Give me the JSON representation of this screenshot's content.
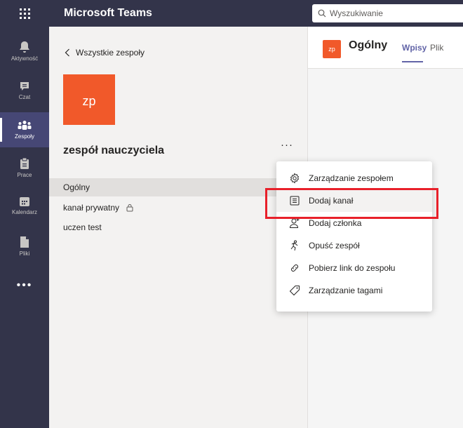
{
  "topbar": {
    "app_title": "Microsoft Teams",
    "search_placeholder": "Wyszukiwanie"
  },
  "rail": {
    "items": [
      {
        "label": "Aktywność",
        "icon": "bell-icon"
      },
      {
        "label": "Czat",
        "icon": "chat-icon"
      },
      {
        "label": "Zespoły",
        "icon": "teams-icon"
      },
      {
        "label": "Prace",
        "icon": "assignments-icon"
      },
      {
        "label": "Kalendarz",
        "icon": "calendar-icon"
      },
      {
        "label": "Pliki",
        "icon": "files-icon"
      }
    ],
    "more": "•••"
  },
  "panel": {
    "back_label": "Wszystkie zespoły",
    "team_initials": "zp",
    "team_name": "zespół nauczyciela",
    "more": "···",
    "channels": [
      {
        "label": "Ogólny"
      },
      {
        "label": "kanał prywatny"
      },
      {
        "label": "uczen test"
      }
    ]
  },
  "main": {
    "team_initials": "zp",
    "channel_title": "Ogólny",
    "tabs": [
      "Wpisy",
      "Plik"
    ]
  },
  "menu": {
    "items": [
      {
        "label": "Zarządzanie zespołem",
        "icon": "gear-icon"
      },
      {
        "label": "Dodaj kanał",
        "icon": "add-channel-icon"
      },
      {
        "label": "Dodaj członka",
        "icon": "add-member-icon"
      },
      {
        "label": "Opuść zespół",
        "icon": "leave-icon"
      },
      {
        "label": "Pobierz link do zespołu",
        "icon": "link-icon"
      },
      {
        "label": "Zarządzanie tagami",
        "icon": "tag-icon"
      }
    ]
  },
  "colors": {
    "rail_bg": "#33344a",
    "accent": "#6264a7",
    "team_avatar": "#f1592a",
    "highlight": "#e8202a"
  }
}
